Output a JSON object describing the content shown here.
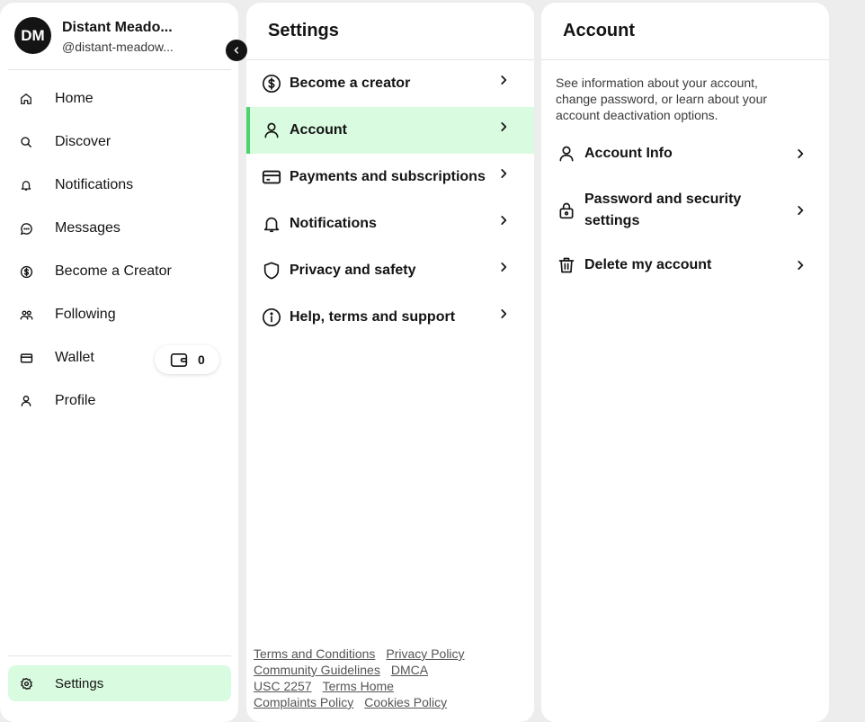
{
  "sidebar": {
    "avatar_initials": "DM",
    "display_name": "Distant Meado...",
    "handle": "@distant-meadow...",
    "collapse_icon": "chevron-left-icon",
    "items": [
      {
        "label": "Home",
        "icon": "home-icon"
      },
      {
        "label": "Discover",
        "icon": "search-icon"
      },
      {
        "label": "Notifications",
        "icon": "bell-icon"
      },
      {
        "label": "Messages",
        "icon": "chat-icon"
      },
      {
        "label": "Become a Creator",
        "icon": "dollar-icon"
      },
      {
        "label": "Following",
        "icon": "people-icon"
      },
      {
        "label": "Wallet",
        "icon": "card-icon"
      },
      {
        "label": "Profile",
        "icon": "person-icon"
      }
    ],
    "wallet_balance": "0",
    "settings_label": "Settings",
    "active_color": "#d9fbe0"
  },
  "settings": {
    "title": "Settings",
    "items": [
      {
        "label": "Become a creator",
        "icon": "dollar-circle-icon"
      },
      {
        "label": "Account",
        "icon": "person-icon"
      },
      {
        "label": "Payments and subscriptions",
        "icon": "credit-card-icon"
      },
      {
        "label": "Notifications",
        "icon": "bell-icon"
      },
      {
        "label": "Privacy and safety",
        "icon": "shield-icon"
      },
      {
        "label": "Help, terms and support",
        "icon": "info-icon"
      }
    ],
    "footer_links": [
      "Terms and Conditions",
      "Privacy Policy",
      "Community Guidelines",
      "DMCA",
      "USC 2257",
      "Terms Home",
      "Complaints Policy",
      "Cookies Policy"
    ],
    "accent_color": "#4ad66b"
  },
  "account": {
    "title": "Account",
    "description": "See information about your account, change password, or learn about your account deactivation options.",
    "items": [
      {
        "label": "Account Info",
        "icon": "person-icon"
      },
      {
        "label": "Password and security settings",
        "icon": "lock-icon"
      },
      {
        "label": "Delete my account",
        "icon": "trash-icon"
      }
    ]
  }
}
